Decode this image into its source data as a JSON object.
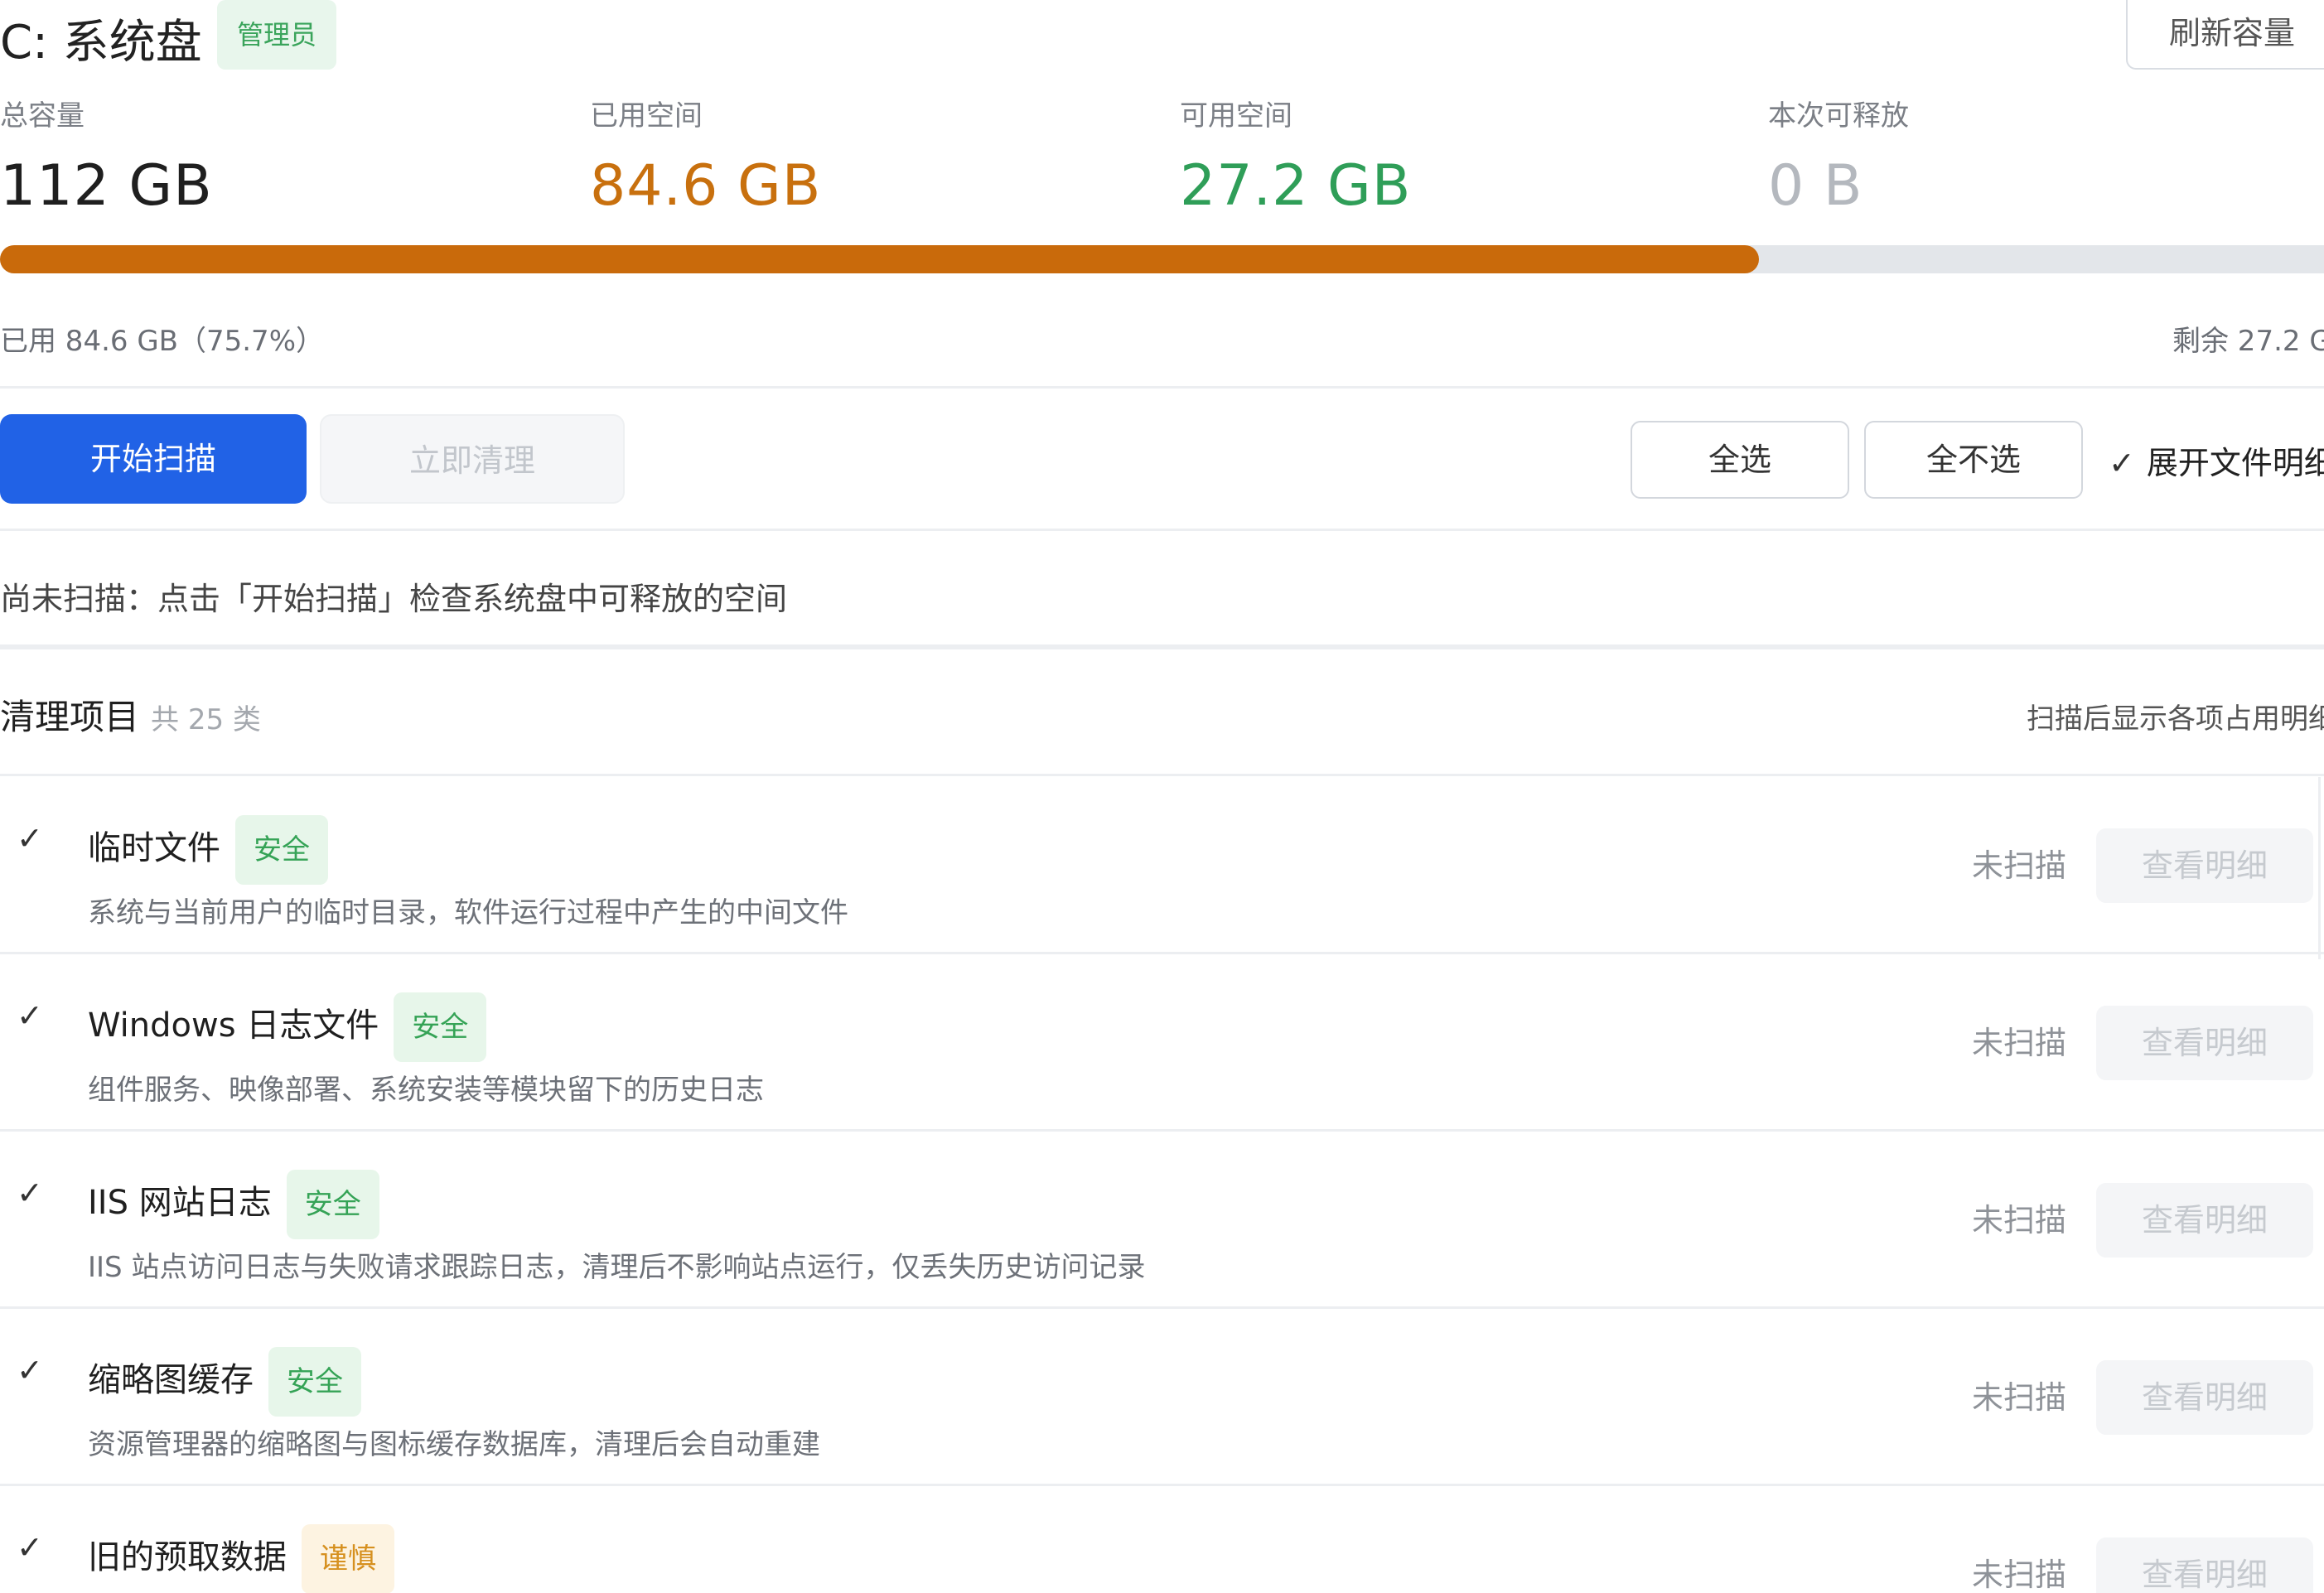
{
  "header": {
    "drive_title": "C: 系统盘",
    "admin_badge": "管理员",
    "refresh_button": "刷新容量"
  },
  "stats": {
    "total_label": "总容量",
    "total_value": "112 GB",
    "used_label": "已用空间",
    "used_value": "84.6 GB",
    "free_label": "可用空间",
    "free_value": "27.2 GB",
    "release_label": "本次可释放",
    "release_value": "0 B",
    "used_fraction": 0.757,
    "colors": {
      "used": "#c8700e",
      "free": "#2f9e58",
      "release": "#b4b8be",
      "bar": "#c96a0b"
    }
  },
  "usage": {
    "used_text": "已用 84.6 GB（75.7%）",
    "remaining_text": "剩余 27.2 G"
  },
  "toolbar": {
    "start_scan": "开始扫描",
    "clean_now": "立即清理",
    "select_all": "全选",
    "select_none": "全不选",
    "expand_check": "✓",
    "expand_label": "展开文件明细"
  },
  "scan_hint": "尚未扫描：点击「开始扫描」检查系统盘中可释放的空间",
  "section": {
    "title": "清理项目",
    "count": "共 25 类",
    "note": "扫描后显示各项占用明细"
  },
  "items": [
    {
      "check": "✓",
      "name": "临时文件",
      "tag": "安全",
      "desc": "系统与当前用户的临时目录，软件运行过程中产生的中间文件",
      "status": "未扫描",
      "detail": "查看明细"
    },
    {
      "check": "✓",
      "name": "Windows 日志文件",
      "tag": "安全",
      "desc": "组件服务、映像部署、系统安装等模块留下的历史日志",
      "status": "未扫描",
      "detail": "查看明细"
    },
    {
      "check": "✓",
      "name": "IIS 网站日志",
      "tag": "安全",
      "desc": "IIS 站点访问日志与失败请求跟踪日志，清理后不影响站点运行，仅丢失历史访问记录",
      "status": "未扫描",
      "detail": "查看明细"
    },
    {
      "check": "✓",
      "name": "缩略图缓存",
      "tag": "安全",
      "desc": "资源管理器的缩略图与图标缓存数据库，清理后会自动重建",
      "status": "未扫描",
      "detail": "查看明细"
    },
    {
      "check": "✓",
      "name": "旧的预取数据",
      "tag": "谨慎",
      "desc": "",
      "status": "未扫描",
      "detail": "查看明细"
    }
  ]
}
